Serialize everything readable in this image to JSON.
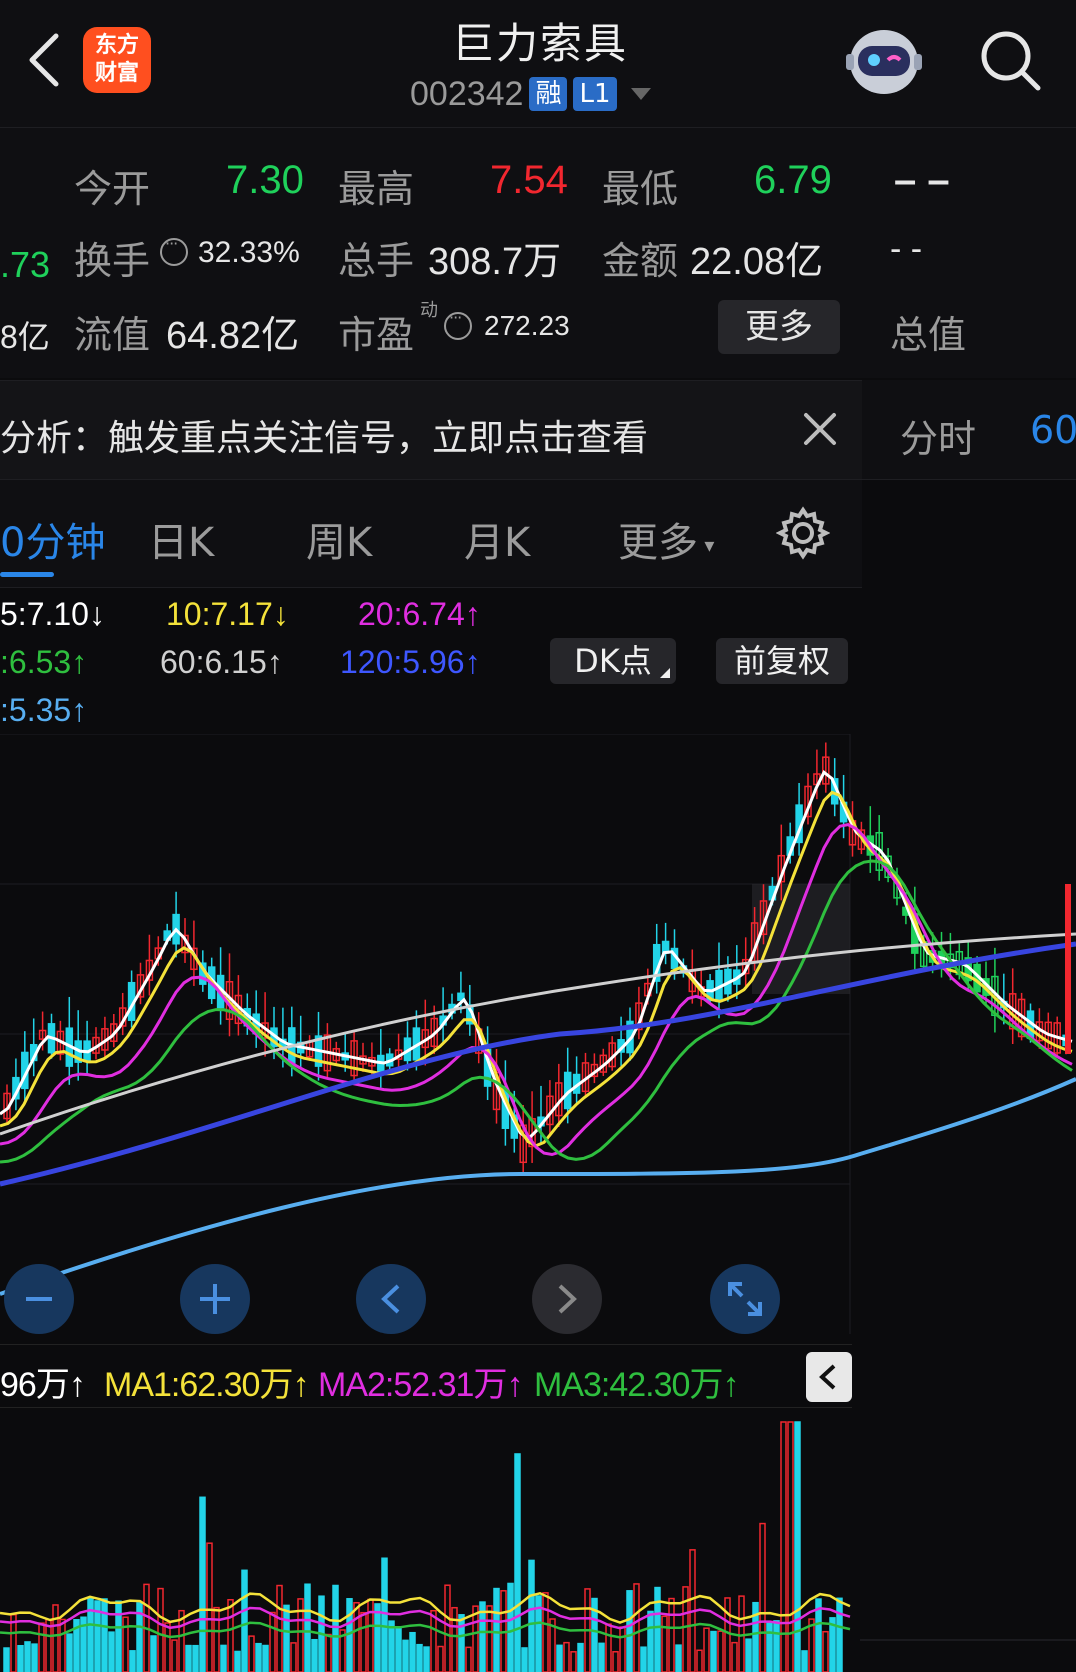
{
  "header": {
    "logo_line1": "东方",
    "logo_line2": "财富",
    "stock_name": "巨力索具",
    "stock_code": "002342",
    "badge_margin": "融",
    "badge_level": "L1"
  },
  "quote": {
    "open_label": "今开",
    "open_value": "7.30",
    "high_label": "最高",
    "high_value": "7.54",
    "low_label": "最低",
    "low_value": "6.79",
    "turnover_label": "换手",
    "turnover_value": "32.33%",
    "volume_label": "总手",
    "volume_value": "308.7万",
    "amount_label": "金额",
    "amount_value": "22.08亿",
    "float_label": "流值",
    "float_value": "64.82亿",
    "pe_label": "市盈",
    "pe_sup": "动",
    "pe_value": "272.23",
    "more_label": "更多",
    "left_edge_1": ".73",
    "left_edge_2": "8亿",
    "right_dash_1": "– –",
    "right_dash_2": "- -",
    "total_value_label": "总值"
  },
  "signal": {
    "text": "分析：触发重点关注信号，立即点击查看"
  },
  "right_tabs": {
    "timeshare": "分时",
    "sixty": "60"
  },
  "periods": {
    "active": "0分钟",
    "day": "日K",
    "week": "周K",
    "month": "月K",
    "more": "更多"
  },
  "ma": {
    "ma5": "5:7.10↓",
    "ma10": "10:7.17↓",
    "ma20": "20:6.74↑",
    "ma30": ":6.53↑",
    "ma60": "60:6.15↑",
    "ma120": "120:5.96↑",
    "ma250": ":5.35↑",
    "dk_label": "DK点",
    "adjust_label": "前复权"
  },
  "colors": {
    "up": "#f2272f",
    "down": "#1fd15b",
    "cyan": "#22d4e8",
    "ma5": "#ffffff",
    "ma10": "#f4e23a",
    "ma20": "#e02ee0",
    "ma30": "#2fbf3f",
    "ma60": "#d0d0d0",
    "ma120": "#3845e0",
    "ma250": "#58aef0",
    "accent": "#2a86e8"
  },
  "volume": {
    "vol": "96万↑",
    "ma1": "MA1:62.30万↑",
    "ma2": "MA2:52.31万↑",
    "ma3": "MA3:42.30万↑"
  },
  "icons": [
    "back-arrow-icon",
    "search-icon",
    "robot-avatar-icon",
    "close-icon",
    "gear-icon",
    "zoom-out-icon",
    "zoom-in-icon",
    "chevron-left-icon",
    "chevron-right-icon",
    "expand-icon"
  ]
}
